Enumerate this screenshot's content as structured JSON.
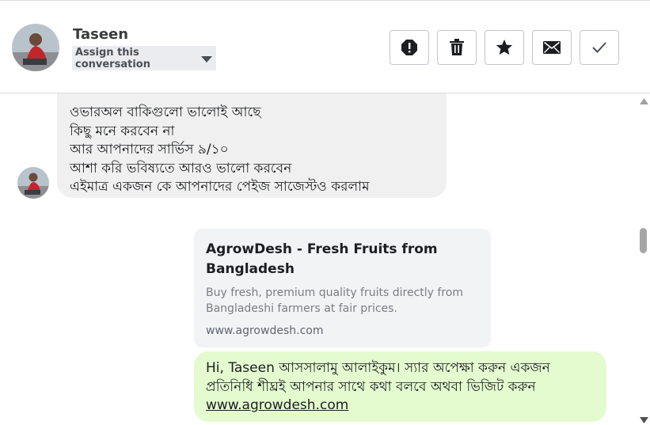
{
  "header": {
    "contact_name": "Taseen",
    "assign_label": "Assign this conversation",
    "actions": [
      {
        "name": "spam",
        "icon": "alert-icon"
      },
      {
        "name": "delete",
        "icon": "trash-icon"
      },
      {
        "name": "star",
        "icon": "star-icon"
      },
      {
        "name": "mark-unread",
        "icon": "envelope-icon"
      },
      {
        "name": "mark-done",
        "icon": "check-icon"
      }
    ]
  },
  "messages": {
    "incoming_lines": [
      "ওভারঅল বাকিগুলো ভালোই আছে",
      "কিছু মনে করবেন না",
      "আর আপনাদের সার্ভিস ৯/১০",
      "আশা করি ভবিষ্যতে আরও ভালো করবেন",
      "এইমাত্র একজন কে আপনাদের পেইজ সাজেস্টও করলাম"
    ],
    "link_preview": {
      "title": "AgrowDesh - Fresh Fruits from Bangladesh",
      "description": "Buy fresh, premium quality fruits directly from Bangladeshi farmers at fair prices.",
      "domain": "www.agrowdesh.com"
    },
    "outgoing": {
      "text": "Hi, Taseen আসসালামু আলাইকুম। স্যার অপেক্ষা করুন একজন প্রতিনিধি শীঘ্রই আপনার সাথে কথা বলবে অথবা ভিজিট করুন",
      "link": "www.agrowdesh.com"
    }
  },
  "colors": {
    "incoming_bubble": "#f0f0f0",
    "outgoing_bubble": "#e4fbcf",
    "link_card": "#f2f3f5"
  }
}
